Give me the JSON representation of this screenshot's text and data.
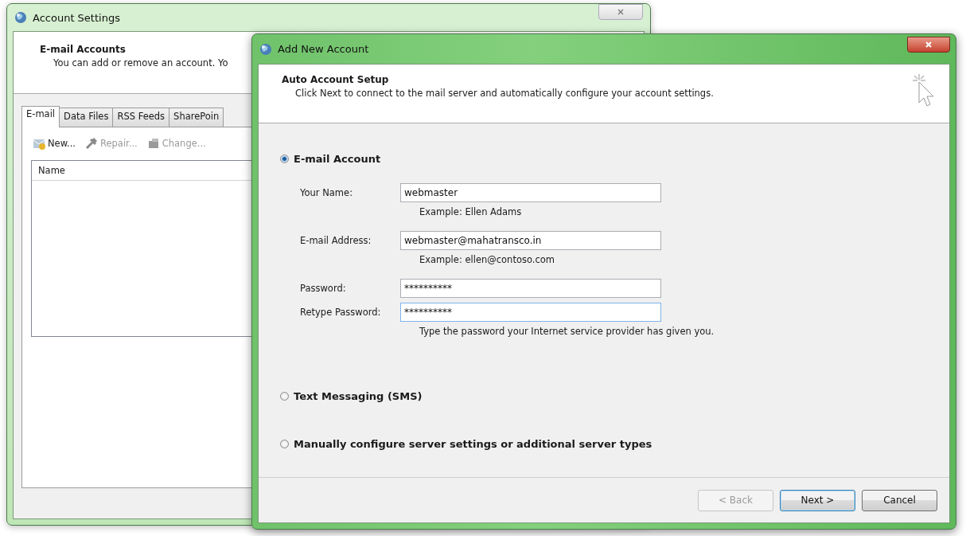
{
  "back_window": {
    "title": "Account Settings",
    "header": {
      "title": "E-mail Accounts",
      "description": "You can add or remove an account. Yo"
    },
    "tabs": [
      {
        "label": "E-mail",
        "selected": true
      },
      {
        "label": "Data Files",
        "selected": false
      },
      {
        "label": "RSS Feeds",
        "selected": false
      },
      {
        "label": "SharePoin",
        "selected": false
      }
    ],
    "toolbar": [
      {
        "label": "New...",
        "kind": "new",
        "disabled": false
      },
      {
        "label": "Repair...",
        "kind": "repair",
        "disabled": true
      },
      {
        "label": "Change...",
        "kind": "change",
        "disabled": true
      }
    ],
    "list": {
      "columns": [
        "Name"
      ]
    }
  },
  "dialog": {
    "title": "Add New Account",
    "header": {
      "title": "Auto Account Setup",
      "description": "Click Next to connect to the mail server and automatically configure your account settings."
    },
    "options": [
      {
        "label": "E-mail Account",
        "selected": true,
        "fields": [
          {
            "label": "Your Name:",
            "value": "webmaster",
            "hint": "Example: Ellen Adams"
          },
          {
            "label": "E-mail Address:",
            "value": "webmaster@mahatransco.in",
            "hint": "Example: ellen@contoso.com"
          },
          {
            "label": "Password:",
            "value": "**********"
          },
          {
            "label": "Retype Password:",
            "value": "**********",
            "focused": true,
            "hint": "Type the password your Internet service provider has given you."
          }
        ]
      },
      {
        "label": "Text Messaging (SMS)",
        "selected": false
      },
      {
        "label": "Manually configure server settings or additional server types",
        "selected": false
      }
    ],
    "buttons": [
      {
        "label": "< Back",
        "disabled": true,
        "default": false
      },
      {
        "label": "Next >",
        "disabled": false,
        "default": true
      },
      {
        "label": "Cancel",
        "disabled": false,
        "default": false
      }
    ]
  }
}
